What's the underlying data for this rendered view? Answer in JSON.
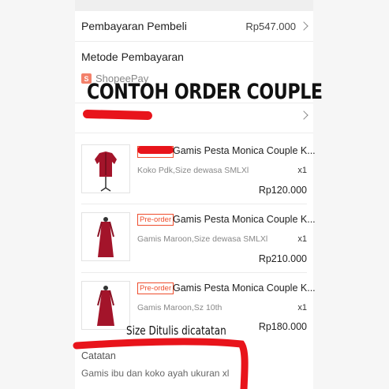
{
  "payment": {
    "label": "Pembayaran Pembeli",
    "amount": "Rp547.000"
  },
  "method": {
    "label": "Metode Pembayaran",
    "provider": "ShopeePay"
  },
  "overlay": {
    "banner": "CONTOH ORDER COUPLE",
    "note": "Size Ditulis dicatatan"
  },
  "items": [
    {
      "tag": "Pre-order",
      "title": "Gamis Pesta Monica Couple K...",
      "variant": "Koko Pdk,Size dewasa SMLXl",
      "qty": "x1",
      "price": "Rp120.000"
    },
    {
      "tag": "Pre-order",
      "title": "Gamis Pesta Monica Couple K...",
      "variant": "Gamis Maroon,Size dewasa SMLXl",
      "qty": "x1",
      "price": "Rp210.000"
    },
    {
      "tag": "Pre-order",
      "title": "Gamis Pesta Monica Couple K...",
      "variant": "Gamis Maroon,Sz 10th",
      "qty": "x1",
      "price": "Rp180.000"
    }
  ],
  "notes": {
    "label": "Catatan",
    "text": "Gamis ibu dan koko ayah ukuran xl"
  },
  "colors": {
    "accent": "#ee4d2d",
    "redaction": "#e8141b",
    "product": "#a3142a"
  }
}
